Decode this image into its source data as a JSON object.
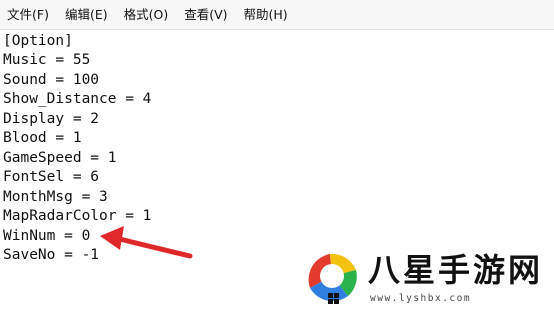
{
  "menu": [
    {
      "label": "文件(F)"
    },
    {
      "label": "编辑(E)"
    },
    {
      "label": "格式(O)"
    },
    {
      "label": "查看(V)"
    },
    {
      "label": "帮助(H)"
    }
  ],
  "editor": {
    "lines": [
      "[Option]",
      "Music = 55",
      "Sound = 100",
      "Show_Distance = 4",
      "Display = 2",
      "Blood = 1",
      "GameSpeed = 1",
      "FontSel = 6",
      "MonthMsg = 3",
      "MapRadarColor = 1",
      "WinNum = 0",
      "SaveNo = -1"
    ]
  },
  "annotation": {
    "color": "#e0282b",
    "icon": "red-arrow-icon"
  },
  "watermark": {
    "brand": "八星手游网",
    "site": "www.lyshbx.com",
    "icon": "colorful-logo-icon"
  }
}
